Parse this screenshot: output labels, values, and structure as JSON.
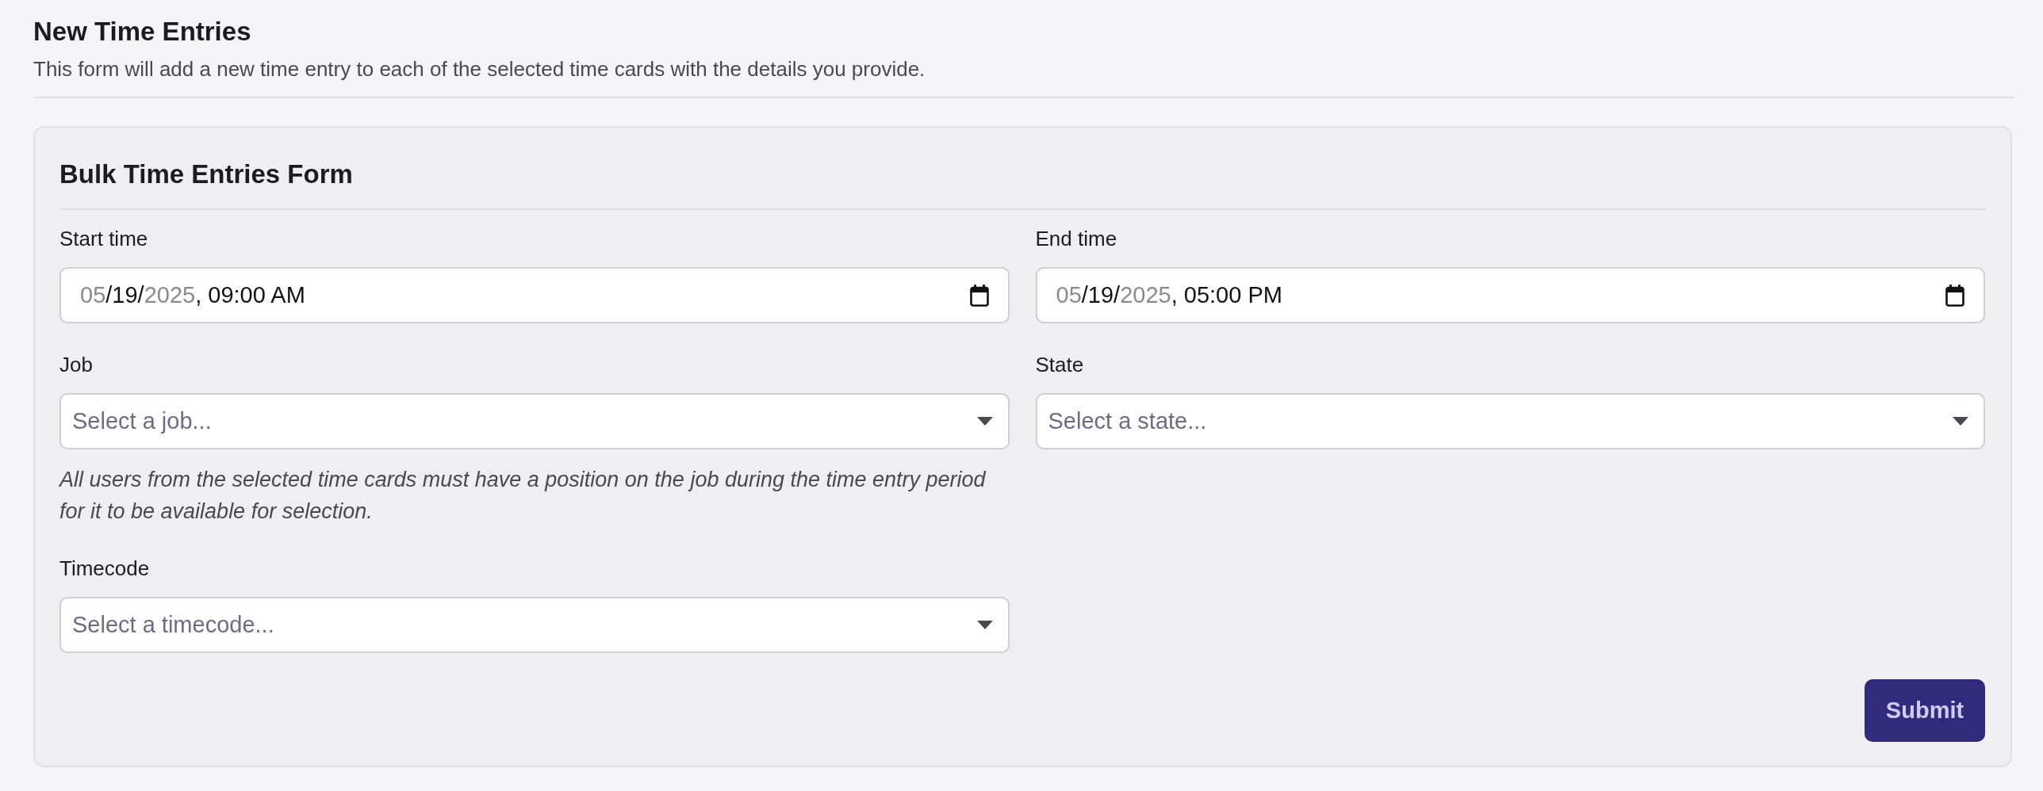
{
  "header": {
    "title": "New Time Entries",
    "description": "This form will add a new time entry to each of the selected time cards with the details you provide."
  },
  "form": {
    "title": "Bulk Time Entries Form",
    "columns": [
      {
        "fields": [
          {
            "kind": "datetime",
            "label": "Start time",
            "value": [
              {
                "text": "05",
                "dimmed": true
              },
              {
                "text": "/19/",
                "dimmed": false
              },
              {
                "text": "2025",
                "dimmed": true
              },
              {
                "text": ", 09:00 AM",
                "dimmed": false
              }
            ]
          },
          {
            "kind": "select",
            "label": "Job",
            "placeholder": "Select a job...",
            "help": "All users from the selected time cards must have a position on the job during the time entry period for it to be available for selection."
          },
          {
            "kind": "select",
            "label": "Timecode",
            "placeholder": "Select a timecode..."
          }
        ]
      },
      {
        "fields": [
          {
            "kind": "datetime",
            "label": "End time",
            "value": [
              {
                "text": "05",
                "dimmed": true
              },
              {
                "text": "/19/",
                "dimmed": false
              },
              {
                "text": "2025",
                "dimmed": true
              },
              {
                "text": ", 05:00 PM",
                "dimmed": false
              }
            ]
          },
          {
            "kind": "select",
            "label": "State",
            "placeholder": "Select a state..."
          }
        ]
      }
    ],
    "submit": "Submit"
  }
}
